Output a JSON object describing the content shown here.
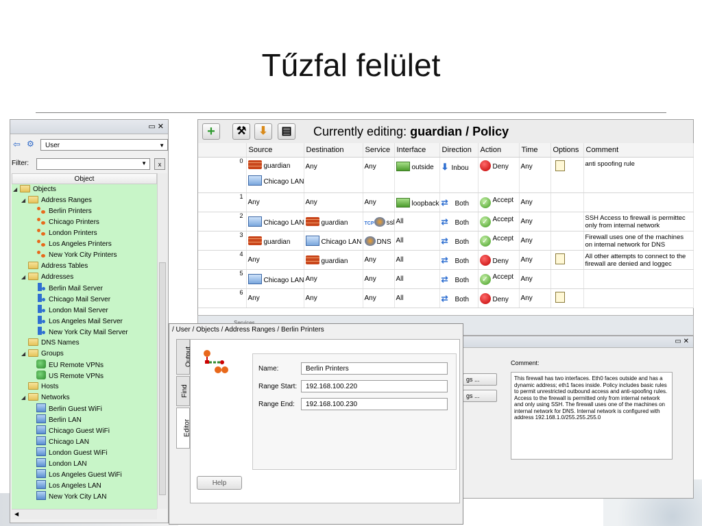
{
  "slide": {
    "title": "Tűzfal felület"
  },
  "tree_panel": {
    "close_label": "✕",
    "user_select": "User",
    "filter_label": "Filter:",
    "filter_clear": "x",
    "column_header": "Object",
    "nodes": [
      {
        "label": "Objects"
      },
      {
        "label": "Address Ranges"
      },
      {
        "label": "Berlin Printers"
      },
      {
        "label": "Chicago Printers"
      },
      {
        "label": "London Printers"
      },
      {
        "label": "Los Angeles Printers"
      },
      {
        "label": "New York City Printers"
      },
      {
        "label": "Address Tables"
      },
      {
        "label": "Addresses"
      },
      {
        "label": "Berlin Mail Server"
      },
      {
        "label": "Chicago Mail Server"
      },
      {
        "label": "London Mail Server"
      },
      {
        "label": "Los Angeles Mail Server"
      },
      {
        "label": "New York City Mail Server"
      },
      {
        "label": "DNS Names"
      },
      {
        "label": "Groups"
      },
      {
        "label": "EU Remote VPNs"
      },
      {
        "label": "US Remote VPNs"
      },
      {
        "label": "Hosts"
      },
      {
        "label": "Networks"
      },
      {
        "label": "Berlin Guest WiFi"
      },
      {
        "label": "Berlin LAN"
      },
      {
        "label": "Chicago Guest WiFi"
      },
      {
        "label": "Chicago LAN"
      },
      {
        "label": "London Guest WiFi"
      },
      {
        "label": "London LAN"
      },
      {
        "label": "Los Angeles Guest WiFi"
      },
      {
        "label": "Los Angeles LAN"
      },
      {
        "label": "New York City LAN"
      }
    ]
  },
  "policy": {
    "editing_prefix": "Currently editing:",
    "editing_target": "guardian / Policy",
    "columns": [
      "Source",
      "Destination",
      "Service",
      "Interface",
      "Direction",
      "Action",
      "Time",
      "Options",
      "Comment"
    ],
    "rows": [
      {
        "num": "0",
        "source": "guardian",
        "source2": "Chicago LAN",
        "destination": "Any",
        "service": "Any",
        "interface": "outside",
        "direction": "Inbou",
        "action": "Deny",
        "time": "Any",
        "comment": "anti spoofing rule"
      },
      {
        "num": "1",
        "source": "Any",
        "destination": "Any",
        "service": "Any",
        "interface": "loopback",
        "direction": "Both",
        "action": "Accept",
        "time": "Any",
        "comment": ""
      },
      {
        "num": "2",
        "source": "Chicago LAN",
        "destination": "guardian",
        "service": "ssh",
        "interface": "All",
        "direction": "Both",
        "action": "Accept",
        "time": "Any",
        "comment": "SSH Access to firewall is permittec only from internal network"
      },
      {
        "num": "3",
        "source": "guardian",
        "destination": "Chicago LAN",
        "service": "DNS",
        "interface": "All",
        "direction": "Both",
        "action": "Accept",
        "time": "Any",
        "comment": "Firewall uses one of the machines on internal network for DNS"
      },
      {
        "num": "4",
        "source": "Any",
        "destination": "guardian",
        "service": "Any",
        "interface": "All",
        "direction": "Both",
        "action": "Deny",
        "time": "Any",
        "comment": "All other attempts to connect to the firewall are denied and loggec"
      },
      {
        "num": "5",
        "source": "Chicago LAN",
        "destination": "Any",
        "service": "Any",
        "interface": "All",
        "direction": "Both",
        "action": "Accept",
        "time": "Any",
        "comment": ""
      },
      {
        "num": "6",
        "source": "Any",
        "destination": "Any",
        "service": "Any",
        "interface": "All",
        "direction": "Both",
        "action": "Deny",
        "time": "Any",
        "comment": ""
      }
    ],
    "tcp_badge": "TCP"
  },
  "editor": {
    "path": "/ User / Objects / Address Ranges / Berlin Printers",
    "tabs": [
      "Output",
      "Find",
      "Editor"
    ],
    "name_label": "Name:",
    "name_value": "Berlin Printers",
    "start_label": "Range Start:",
    "start_value": "192.168.100.220",
    "end_label": "Range End:",
    "end_value": "192.168.100.230",
    "help_label": "Help"
  },
  "comment_panel": {
    "label": "Comment:",
    "btn1": "gs ...",
    "btn2": "gs ...",
    "text": "This firewall has two interfaces. Eth0 faces outside and has a dynamic address; eth1 faces inside. Policy includes basic rules to permit unrestricted outbound access and anti-spoofing rules. Access to the firewall is permitted only from internal network and only using SSH. The firewall uses one of the machines on internal network for DNS. Internal network is configured with address 192.168.1.0/255.255.255.0"
  },
  "behind": {
    "label": "Services"
  },
  "colors": {
    "tree_bg": "#c8f5c8",
    "accent": "#2f6fd1",
    "deny": "#c00000",
    "accept": "#3f9a1e"
  }
}
